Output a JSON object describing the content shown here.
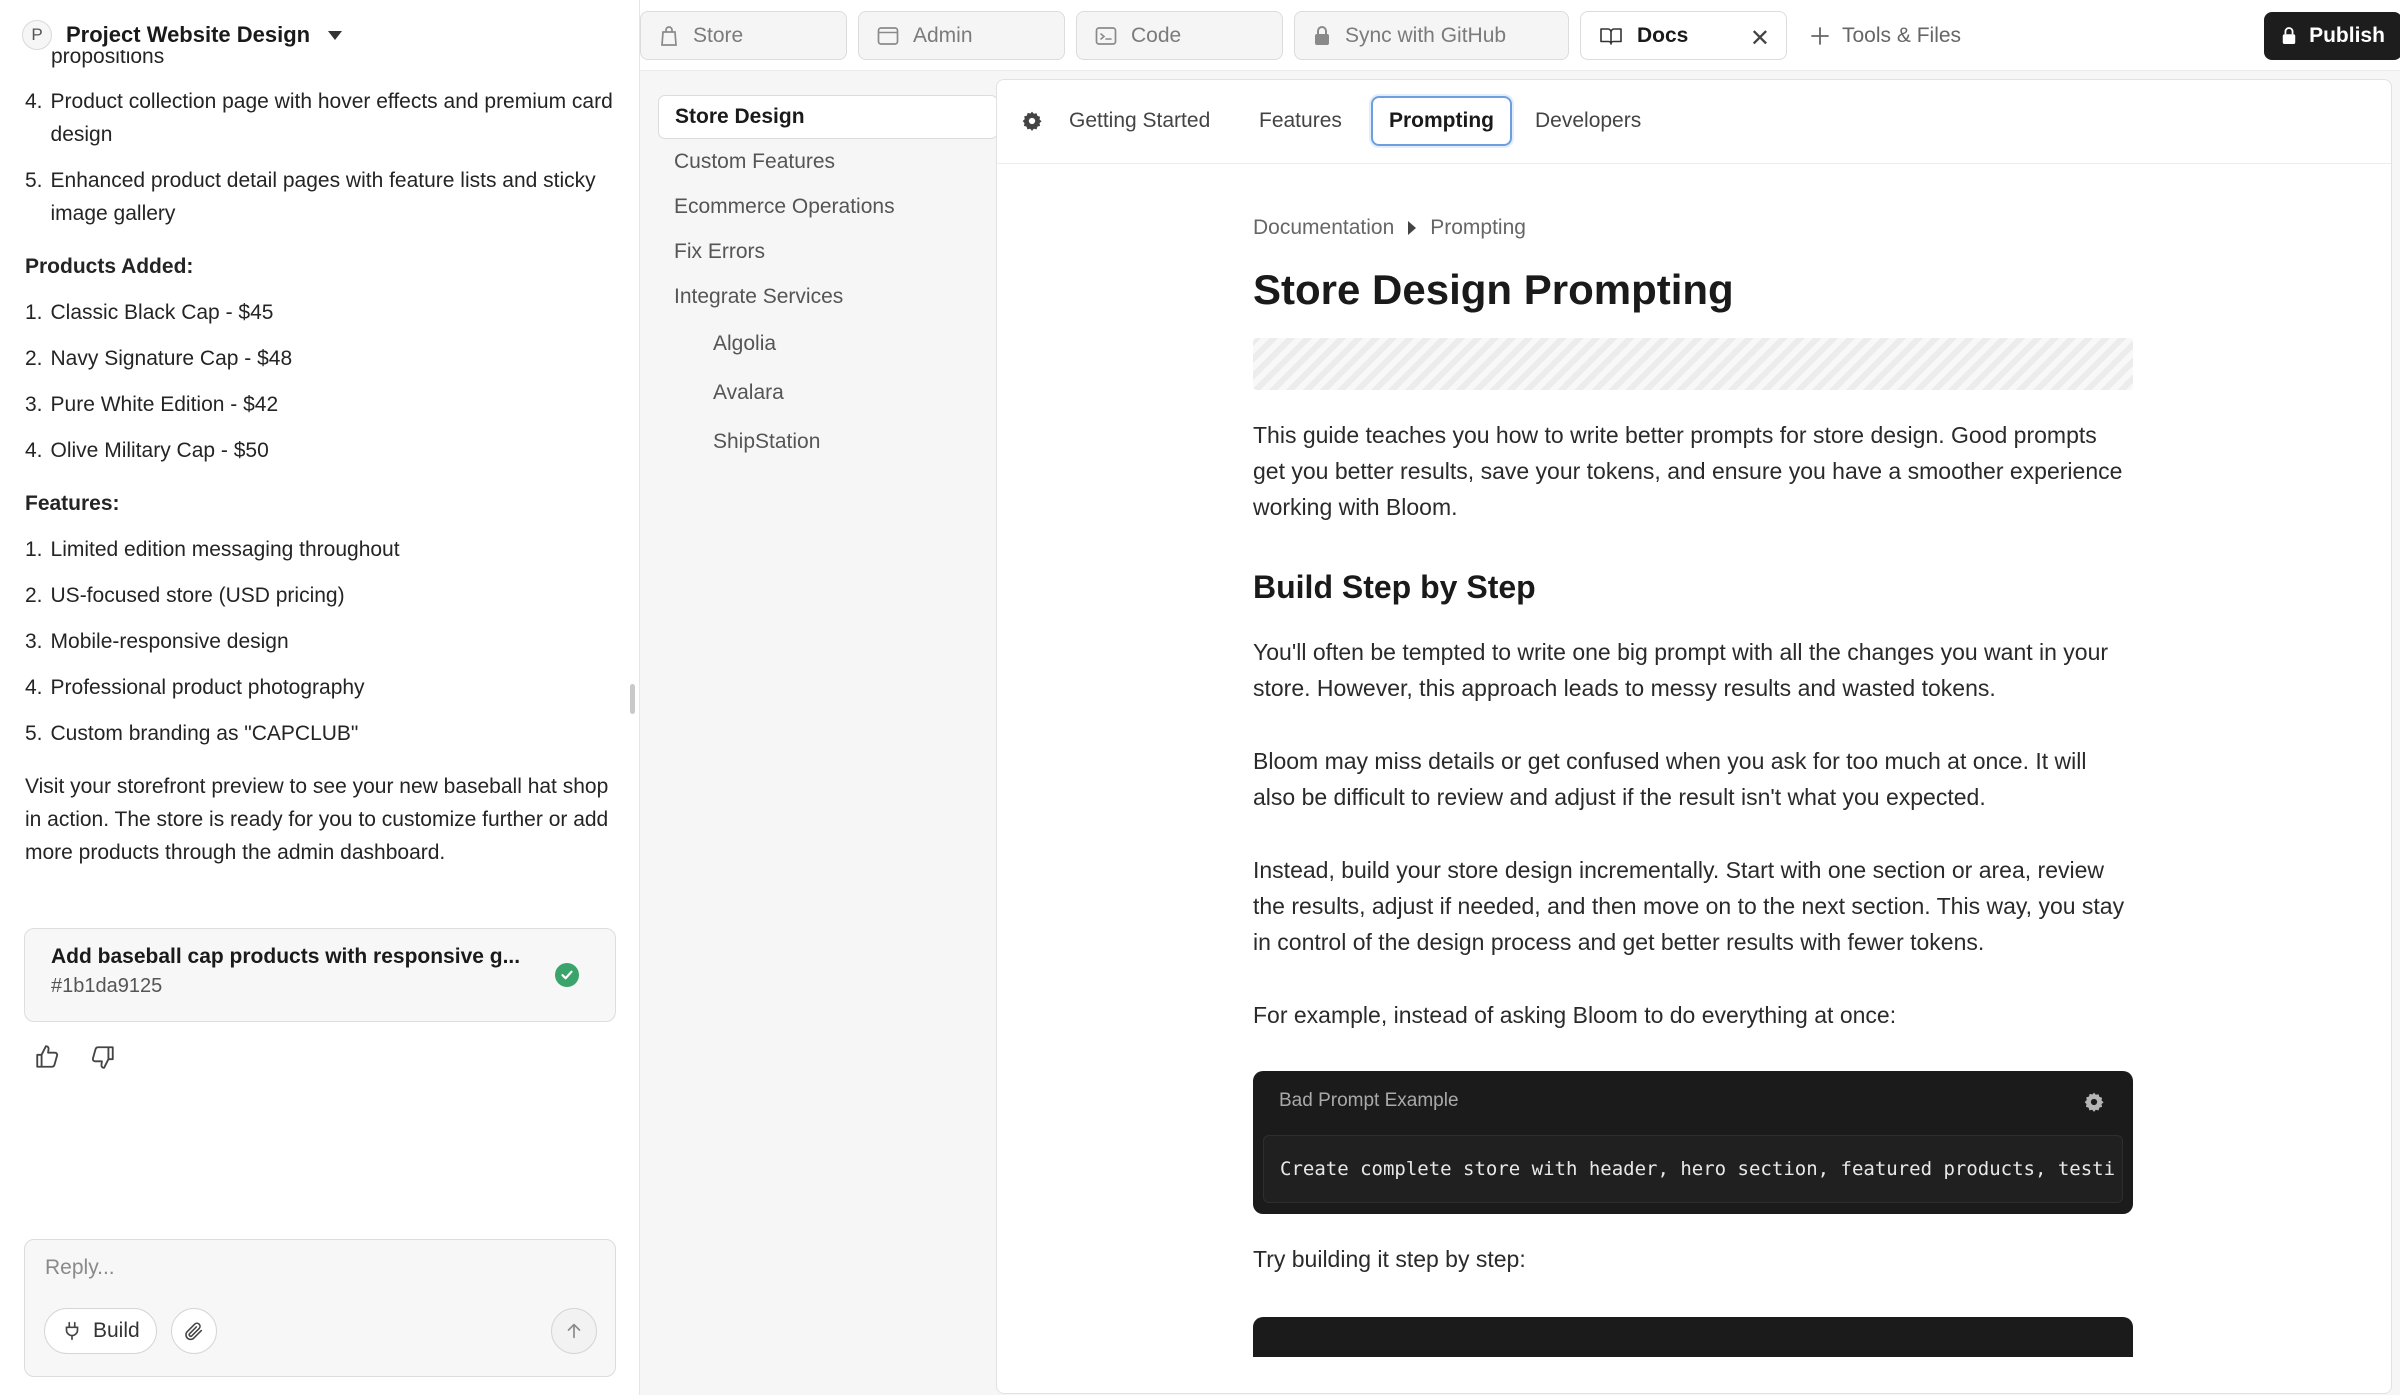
{
  "project": {
    "avatar_letter": "P",
    "name": "Project Website Design"
  },
  "chat": {
    "fragment": "propositions",
    "top_items": [
      {
        "num": "4.",
        "text": "Product collection page with hover effects and premium card design"
      },
      {
        "num": "5.",
        "text": "Enhanced product detail pages with feature lists and sticky image gallery"
      }
    ],
    "products_heading": "Products Added:",
    "products": [
      {
        "num": "1.",
        "text": "Classic Black Cap - $45"
      },
      {
        "num": "2.",
        "text": "Navy Signature Cap - $48"
      },
      {
        "num": "3.",
        "text": "Pure White Edition - $42"
      },
      {
        "num": "4.",
        "text": "Olive Military Cap - $50"
      }
    ],
    "features_heading": "Features:",
    "features": [
      {
        "num": "1.",
        "text": "Limited edition messaging throughout"
      },
      {
        "num": "2.",
        "text": "US-focused store (USD pricing)"
      },
      {
        "num": "3.",
        "text": "Mobile-responsive design"
      },
      {
        "num": "4.",
        "text": "Professional product photography"
      },
      {
        "num": "5.",
        "text": "Custom branding as \"CAPCLUB\""
      }
    ],
    "closing": "Visit your storefront preview to see your new baseball hat shop in action. The store is ready for you to customize further or add more products through the admin dashboard.",
    "commit": {
      "title": "Add baseball cap products with responsive g...",
      "hash": "#1b1da9125"
    },
    "composer": {
      "placeholder": "Reply...",
      "build_label": "Build"
    }
  },
  "tabs": [
    {
      "label": "Store",
      "icon": "bag-icon"
    },
    {
      "label": "Admin",
      "icon": "window-icon"
    },
    {
      "label": "Code",
      "icon": "terminal-icon"
    },
    {
      "label": "Sync with GitHub",
      "icon": "lock-icon"
    },
    {
      "label": "Docs",
      "icon": "book-icon",
      "active": true
    }
  ],
  "tools_label": "Tools & Files",
  "publish_label": "Publish",
  "docs_nav": [
    {
      "label": "Store Design",
      "active": true
    },
    {
      "label": "Custom Features"
    },
    {
      "label": "Ecommerce Operations"
    },
    {
      "label": "Fix Errors"
    },
    {
      "label": "Integrate Services"
    },
    {
      "label": "Algolia",
      "sub": true
    },
    {
      "label": "Avalara",
      "sub": true
    },
    {
      "label": "ShipStation",
      "sub": true
    }
  ],
  "doc_tabs": [
    {
      "label": "Getting Started"
    },
    {
      "label": "Features"
    },
    {
      "label": "Prompting",
      "active": true
    },
    {
      "label": "Developers"
    }
  ],
  "article": {
    "breadcrumb": [
      "Documentation",
      "Prompting"
    ],
    "title": "Store Design Prompting",
    "intro": "This guide teaches you how to write better prompts for store design. Good prompts get you better results, save your tokens, and ensure you have a smoother experience working with Bloom.",
    "h2": "Build Step by Step",
    "p1": "You'll often be tempted to write one big prompt with all the changes you want in your store. However, this approach leads to messy results and wasted tokens.",
    "p2": "Bloom may miss details or get confused when you ask for too much at once. It will also be difficult to review and adjust if the result isn't what you expected.",
    "p3": "Instead, build your store design incrementally. Start with one section or area, review the results, adjust if needed, and then move on to the next section. This way, you stay in control of the design process and get better results with fewer tokens.",
    "p4": "For example, instead of asking Bloom to do everything at once:",
    "code_label": "Bad Prompt Example",
    "code": "Create complete store with header, hero section, featured products, testi",
    "p5": "Try building it step by step:"
  },
  "colors": {
    "accent": "#6d9ee0",
    "success": "#3aa46b",
    "publish_bg": "#1d1d1d",
    "code_bg": "#1b1b1b"
  }
}
